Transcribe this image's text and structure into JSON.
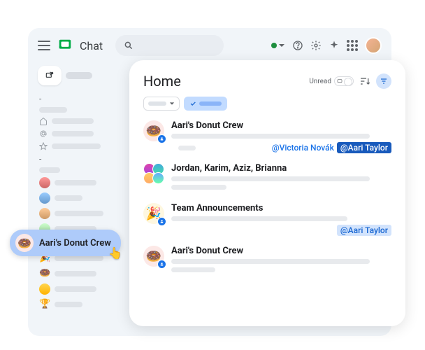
{
  "app": {
    "name": "Chat"
  },
  "header": {
    "icons": {
      "help": "help-icon",
      "settings": "gear-icon",
      "gemini": "sparkle-icon",
      "apps": "apps-grid-icon"
    }
  },
  "sidebar": {
    "compose_label": "New chat"
  },
  "panel": {
    "title": "Home",
    "unread_label": "Unread"
  },
  "conversations": [
    {
      "title": "Aari's Donut Crew",
      "mention1": "@Victoria Novák",
      "mention2": "@Aari Taylor"
    },
    {
      "title": "Jordan, Karim, Aziz, Brianna"
    },
    {
      "title": "Team Announcements",
      "mention": "@Aari Taylor"
    },
    {
      "title": "Aari's Donut Crew"
    }
  ],
  "tooltip": {
    "text": "Aari's Donut Crew"
  }
}
